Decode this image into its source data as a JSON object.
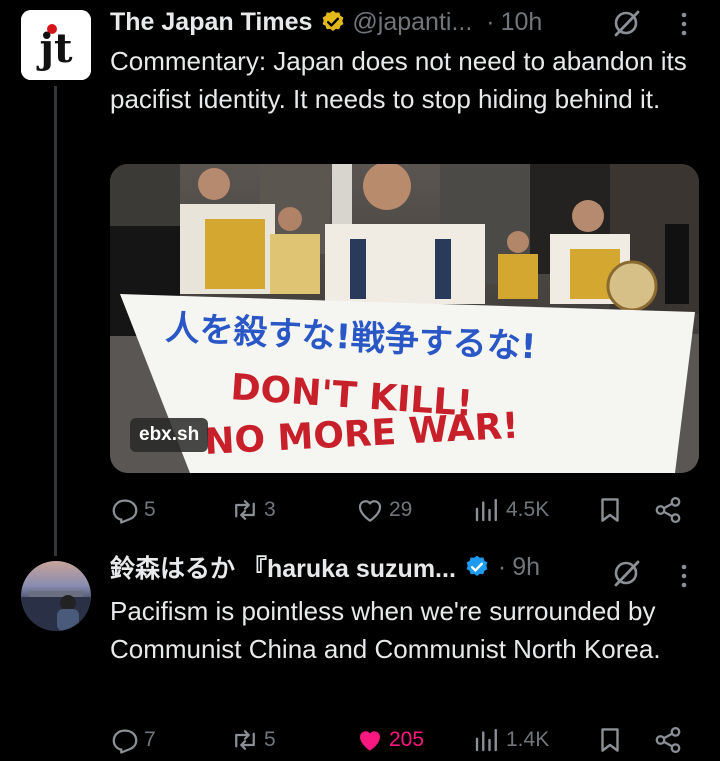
{
  "tweets": [
    {
      "author_name": "The Japan Times",
      "author_handle": "@japanti...",
      "separator": "·",
      "time": "10h",
      "verified": "gold-check-icon",
      "avatar_text": "jt",
      "text": "Commentary: Japan does not need to abandon its pacifist identity. It needs to stop hiding behind it.",
      "media": {
        "banner_jp": "人を殺すな!戦争するな!",
        "banner_line1": "DON'T KILL!",
        "banner_line2": "NO MORE WAR!",
        "watermark": "ebx.sh"
      },
      "replies": "5",
      "reposts": "3",
      "likes": "29",
      "views": "4.5K"
    },
    {
      "author_name": "鈴森はるか 『haruka suzum...",
      "separator": "·",
      "time": "9h",
      "verified": "blue-check-icon",
      "text": "Pacifism is pointless when we're surrounded by Communist China and Communist North Korea.",
      "replies": "7",
      "reposts": "5",
      "likes": "205",
      "views": "1.4K",
      "liked": true
    }
  ],
  "colors": {
    "background": "#000000",
    "text": "#e7e9ea",
    "muted": "#71767b",
    "like": "#f91880",
    "verified_blue": "#1d9bf0",
    "verified_gold": "#e2b719",
    "banner_blue": "#2a57c6",
    "banner_red": "#c8202a"
  }
}
